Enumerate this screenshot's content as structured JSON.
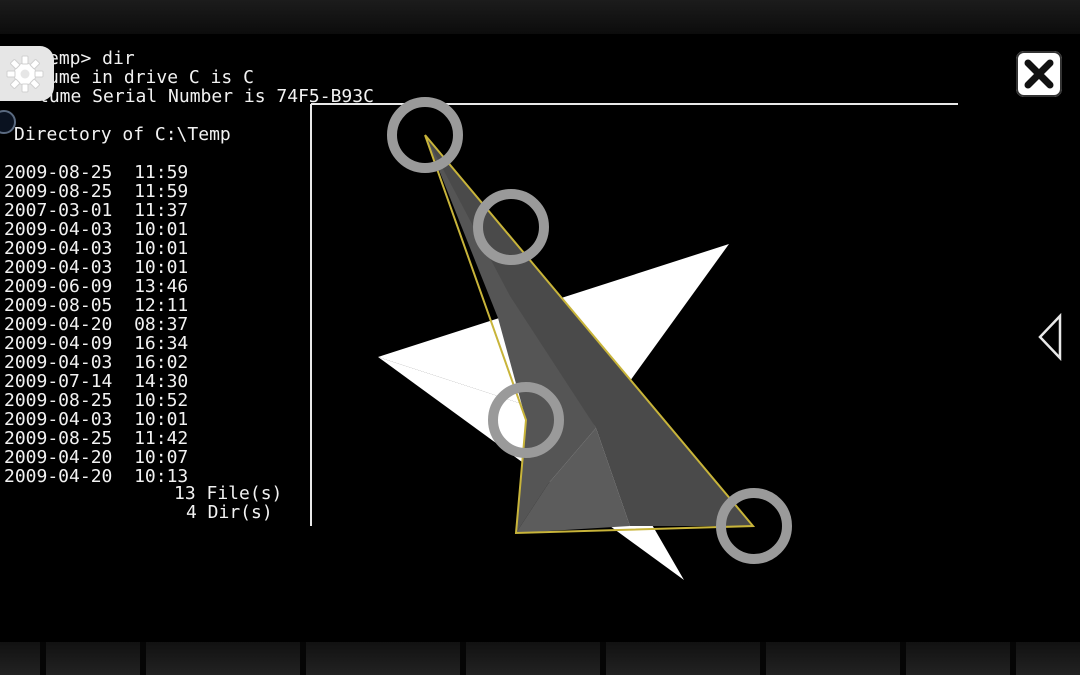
{
  "terminal": {
    "prompt_line": "emp> dir",
    "volume_line": "ume in drive C is C",
    "serial_line": "lume Serial Number is 74F5-B93C",
    "directory_line": "Directory of C:\\Temp",
    "entries": [
      {
        "date": "2009-08-25",
        "time": "11:59"
      },
      {
        "date": "2009-08-25",
        "time": "11:59"
      },
      {
        "date": "2007-03-01",
        "time": "11:37"
      },
      {
        "date": "2009-04-03",
        "time": "10:01"
      },
      {
        "date": "2009-04-03",
        "time": "10:01"
      },
      {
        "date": "2009-04-03",
        "time": "10:01"
      },
      {
        "date": "2009-06-09",
        "time": "13:46"
      },
      {
        "date": "2009-08-05",
        "time": "12:11"
      },
      {
        "date": "2009-04-20",
        "time": "08:37"
      },
      {
        "date": "2009-04-09",
        "time": "16:34"
      },
      {
        "date": "2009-04-03",
        "time": "16:02"
      },
      {
        "date": "2009-07-14",
        "time": "14:30"
      },
      {
        "date": "2009-08-25",
        "time": "10:52"
      },
      {
        "date": "2009-04-03",
        "time": "10:01"
      },
      {
        "date": "2009-08-25",
        "time": "11:42"
      },
      {
        "date": "2009-04-20",
        "time": "10:07"
      },
      {
        "date": "2009-04-20",
        "time": "10:13"
      }
    ],
    "files_summary": "13 File(s)",
    "dirs_summary": "4 Dir(s)"
  },
  "icons": {
    "settings": "gear-icon",
    "close": "close-icon",
    "next": "chevron-left-icon"
  },
  "puzzle": {
    "handles_count": 4,
    "colors": {
      "white_triangle": "#ffffff",
      "gray_fill": "#5a5a5a",
      "outline": "#c8b43a",
      "handle_ring": "#9a9a9a"
    }
  }
}
